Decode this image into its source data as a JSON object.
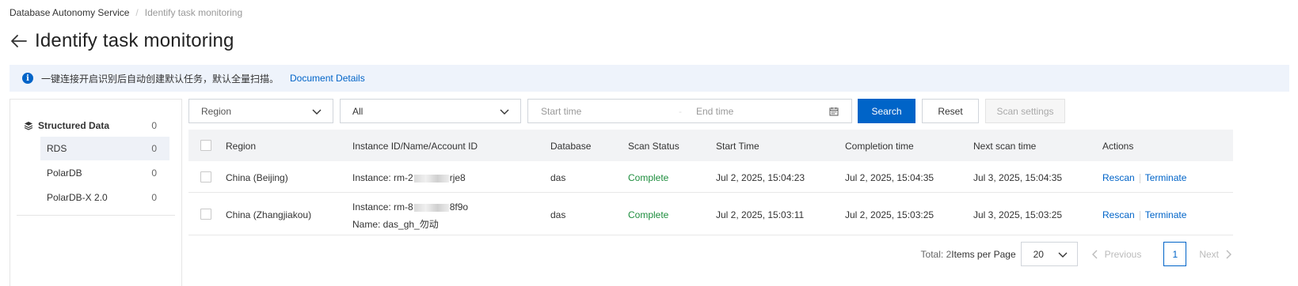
{
  "breadcrumb": {
    "root": "Database Autonomy Service",
    "separator": "/",
    "current": "Identify task monitoring"
  },
  "page": {
    "title": "Identify task monitoring"
  },
  "notice": {
    "icon": "info-icon",
    "text": "一键连接开启识别后自动创建默认任务，默认全量扫描。",
    "link": "Document Details"
  },
  "sidebar": {
    "group": {
      "label": "Structured Data",
      "count": "0",
      "icon": "layers-icon"
    },
    "items": [
      {
        "label": "RDS",
        "count": "0",
        "active": true
      },
      {
        "label": "PolarDB",
        "count": "0",
        "active": false
      },
      {
        "label": "PolarDB-X 2.0",
        "count": "0",
        "active": false
      }
    ]
  },
  "filters": {
    "region_placeholder": "Region",
    "type_value": "All",
    "start_placeholder": "Start time",
    "range_separator": "-",
    "end_placeholder": "End time",
    "search_label": "Search",
    "reset_label": "Reset",
    "scan_settings_label": "Scan settings"
  },
  "table": {
    "headers": [
      "Region",
      "Instance ID/Name/Account ID",
      "Database",
      "Scan Status",
      "Start Time",
      "Completion time",
      "Next scan time",
      "Actions"
    ],
    "rows": [
      {
        "region": "China (Beijing)",
        "instance_prefix": "Instance: rm-2",
        "instance_suffix": "rje8",
        "name": "",
        "database": "das",
        "status": "Complete",
        "start": "Jul 2, 2025, 15:04:23",
        "completion": "Jul 2, 2025, 15:04:35",
        "next": "Jul 3, 2025, 15:04:35",
        "rescan": "Rescan",
        "terminate": "Terminate"
      },
      {
        "region": "China (Zhangjiakou)",
        "instance_prefix": "Instance: rm-8",
        "instance_suffix": "8f9o",
        "name": "Name: das_gh_勿动",
        "database": "das",
        "status": "Complete",
        "start": "Jul 2, 2025, 15:03:11",
        "completion": "Jul 2, 2025, 15:03:25",
        "next": "Jul 3, 2025, 15:03:25",
        "rescan": "Rescan",
        "terminate": "Terminate"
      }
    ]
  },
  "pagination": {
    "total_text": "Total: 2",
    "items_per_page_label": "Items per Page",
    "page_size": "20",
    "previous_label": "Previous",
    "current_page": "1",
    "next_label": "Next"
  },
  "colors": {
    "primary": "#0064c8",
    "success": "#1e8e3e",
    "notice_bg": "#eef3fb"
  }
}
